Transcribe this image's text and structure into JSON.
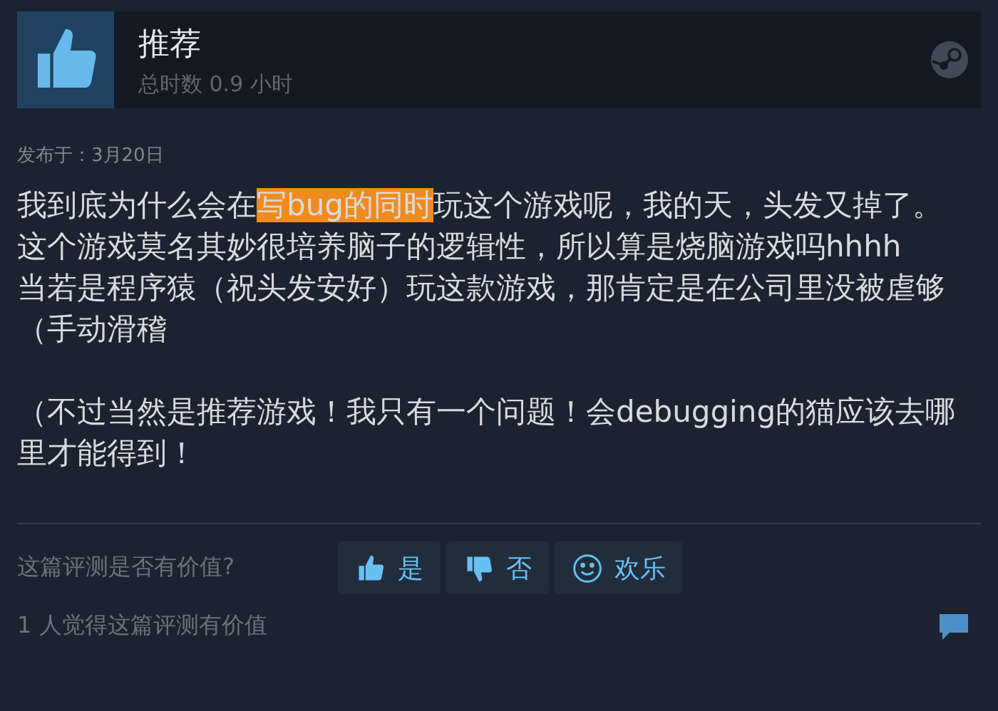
{
  "review": {
    "verdict": "推荐",
    "hours": "总时数 0.9 小时",
    "posted": "发布于：3月20日"
  },
  "paragraphs": [
    {
      "segments": [
        {
          "text": "我到底为什么会在",
          "highlight": false
        },
        {
          "text": "写bug的同时",
          "highlight": true
        },
        {
          "text": "玩这个游戏呢，我的天，头发又掉了。",
          "highlight": false
        }
      ]
    },
    {
      "segments": [
        {
          "text": "这个游戏莫名其妙很培养脑子的逻辑性，所以算是烧脑游戏吗hhhh",
          "highlight": false
        }
      ]
    },
    {
      "segments": [
        {
          "text": "当若是程序猿（祝头发安好）玩这款游戏，那肯定是在公司里没被虐够（手动滑稽",
          "highlight": false
        }
      ]
    }
  ],
  "postscript": "（不过当然是推荐游戏！我只有一个问题！会debugging的猫应该去哪里才能得到！",
  "feedback": {
    "question": "这篇评测是否有价值?",
    "buttons": [
      {
        "kind": "up",
        "label": "是"
      },
      {
        "kind": "down",
        "label": "否"
      },
      {
        "kind": "funny",
        "label": "欢乐"
      }
    ],
    "summary": "1 人觉得这篇评测有价值"
  }
}
